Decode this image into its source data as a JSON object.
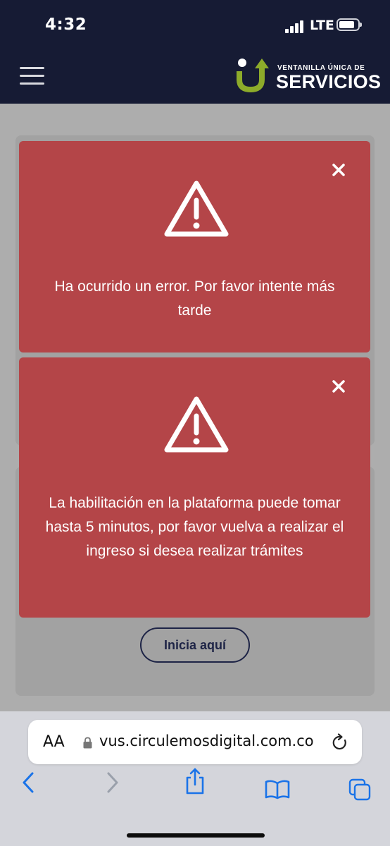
{
  "status_bar": {
    "time": "4:32",
    "network": "LTE"
  },
  "header": {
    "logo_line1": "VENTANILLA ÚNICA DE",
    "logo_line2": "SERVICIOS"
  },
  "background_page": {
    "button_label": "Inicia aquí"
  },
  "alerts": [
    {
      "message": "Ha ocurrido un error. Por favor intente más tarde"
    },
    {
      "message": "La habilitación en la plataforma puede tomar hasta 5 minutos, por favor vuelva a realizar el ingreso si desea realizar trámites"
    }
  ],
  "browser": {
    "text_size_label": "AA",
    "url": "vus.circulemosdigital.com.co"
  },
  "colors": {
    "header_bg": "#161b34",
    "alert_bg": "#b44548",
    "logo_green": "#8dab2a",
    "ios_blue": "#1a73e8"
  }
}
